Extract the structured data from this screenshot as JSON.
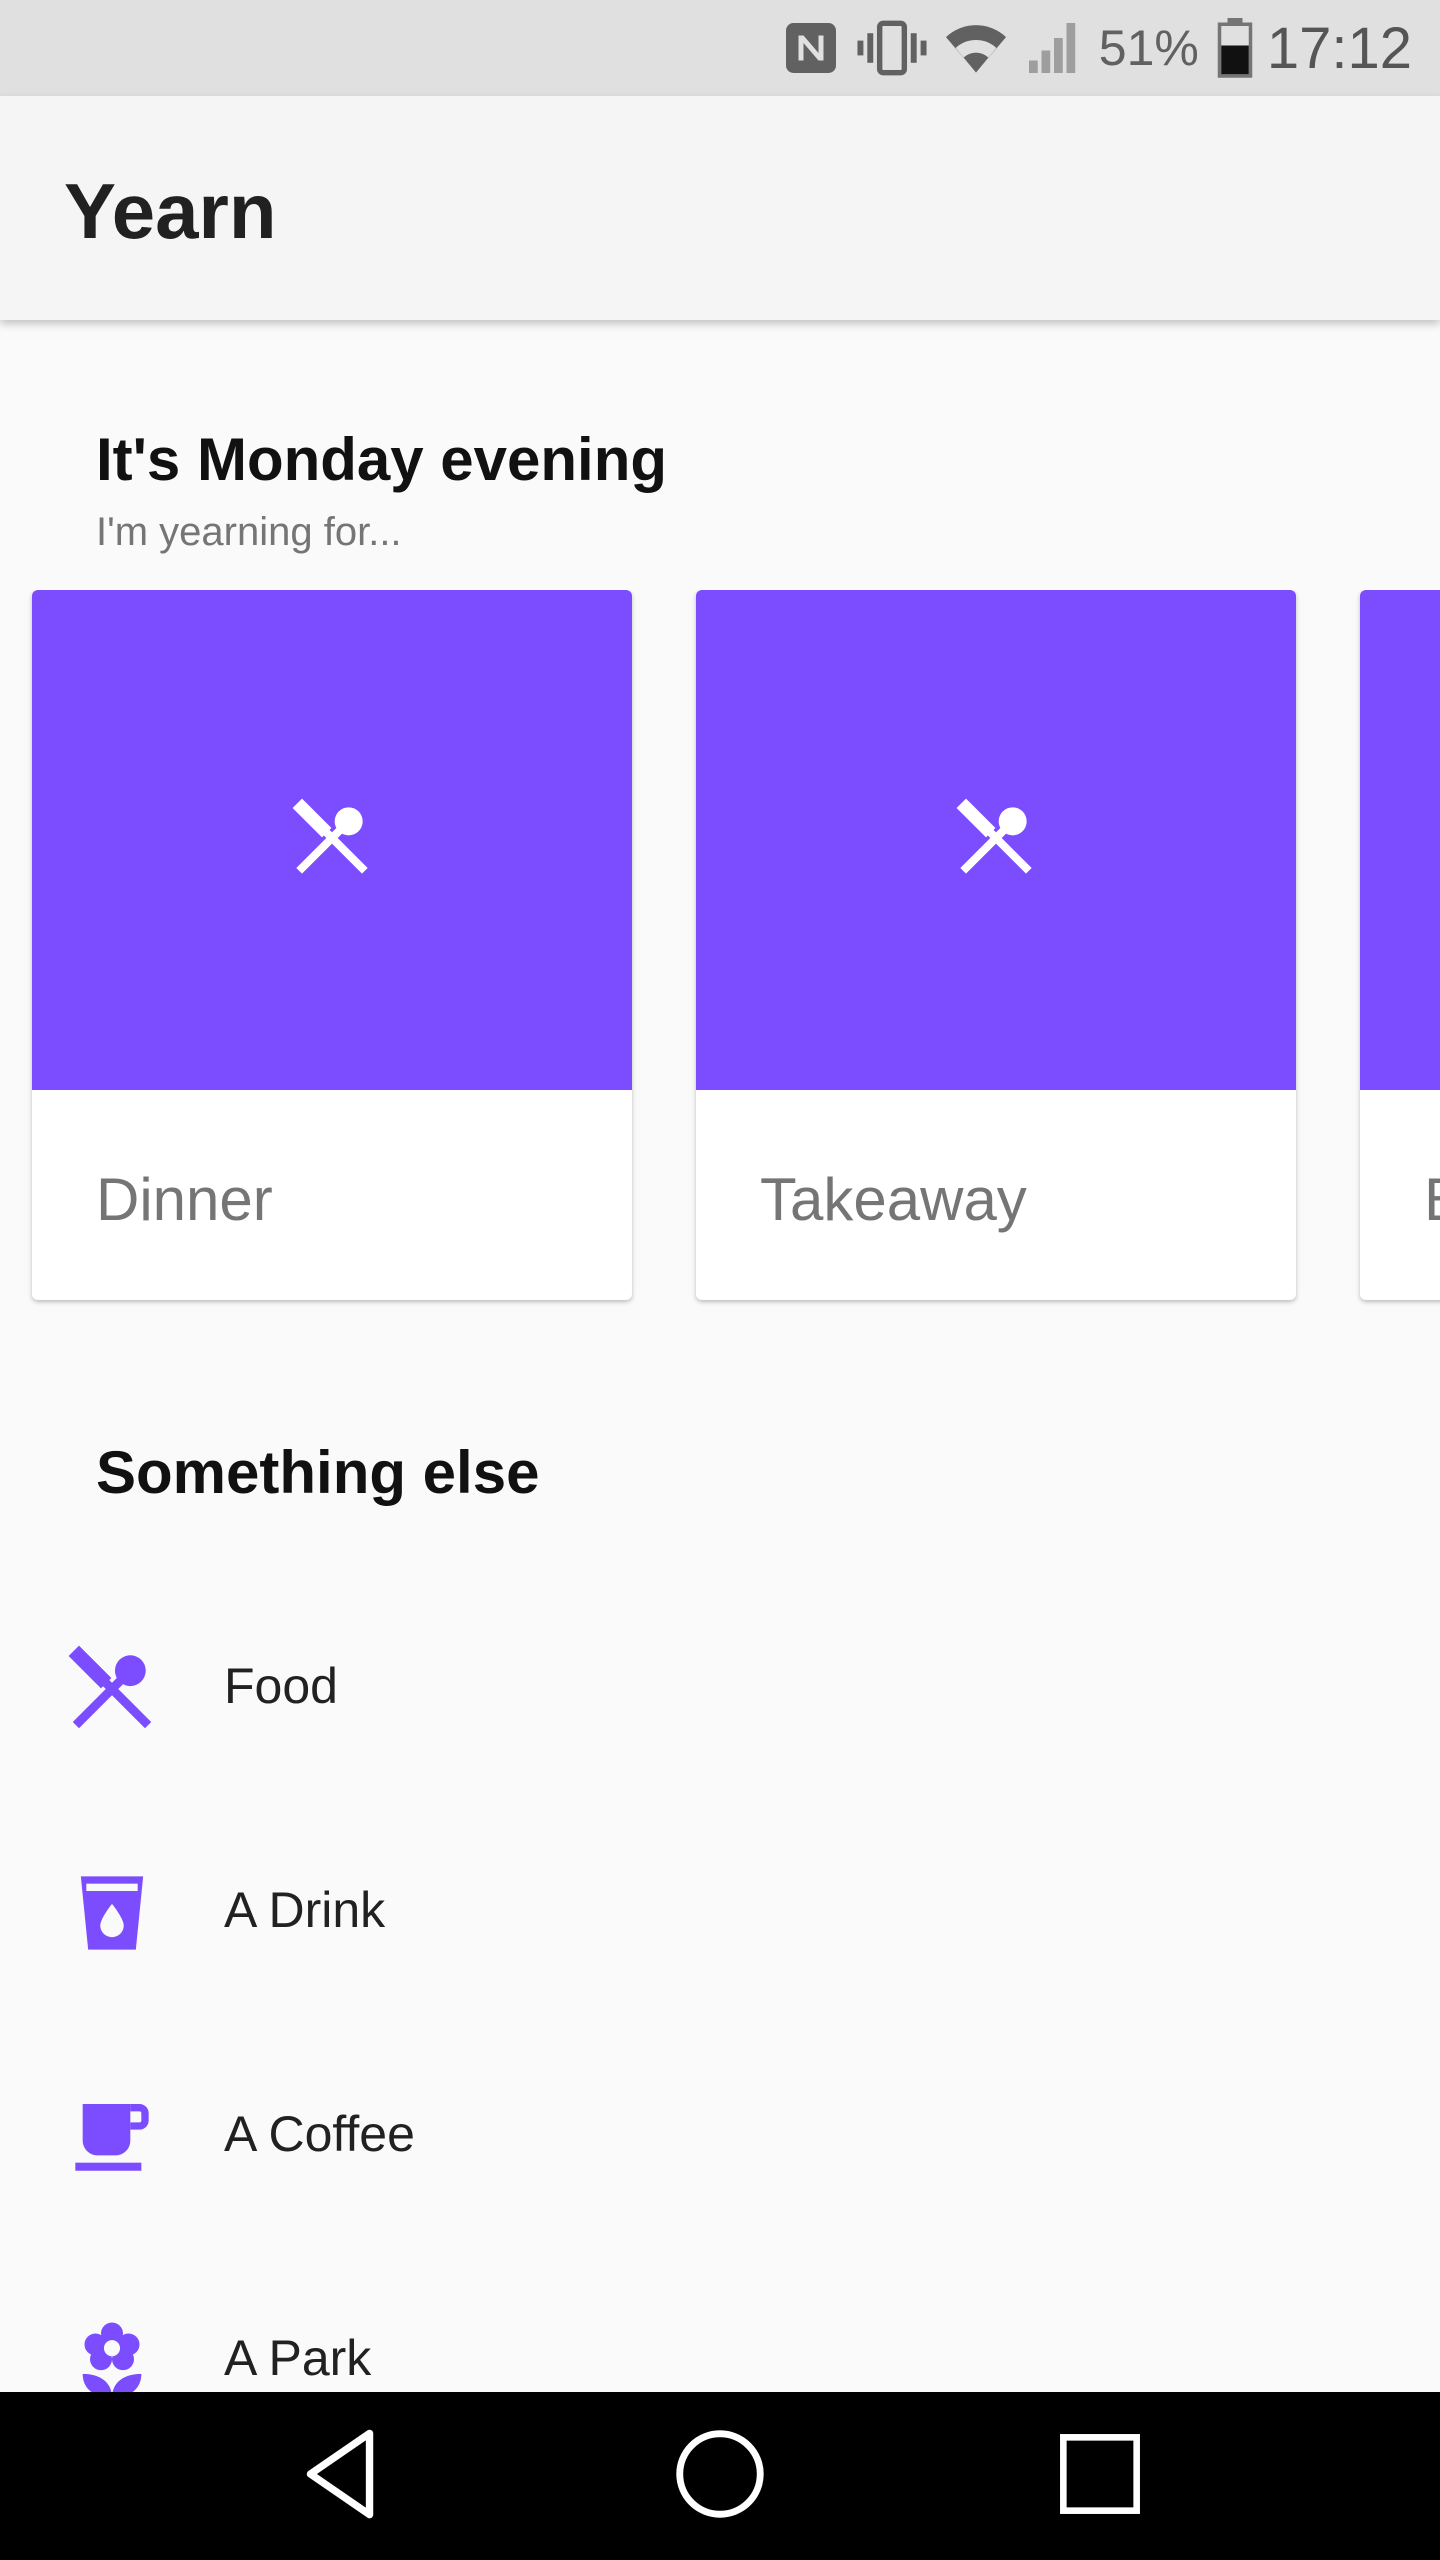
{
  "status_bar": {
    "battery_percent": "51%",
    "time": "17:12"
  },
  "app_bar": {
    "title": "Yearn"
  },
  "greeting": {
    "title": "It's Monday evening",
    "subtitle": "I'm yearning for..."
  },
  "cards": [
    {
      "label": "Dinner",
      "icon": "fork-spoon-icon"
    },
    {
      "label": "Takeaway",
      "icon": "fork-spoon-icon"
    },
    {
      "label": "B",
      "icon": "fork-spoon-icon"
    }
  ],
  "something_else": {
    "title": "Something else",
    "items": [
      {
        "label": "Food",
        "icon": "fork-spoon-icon"
      },
      {
        "label": "A Drink",
        "icon": "drink-cup-icon"
      },
      {
        "label": "A Coffee",
        "icon": "coffee-cup-icon"
      },
      {
        "label": "A Park",
        "icon": "flower-icon"
      }
    ]
  },
  "colors": {
    "accent": "#7c4dff",
    "status_bar": "#e0e0e0",
    "app_bar": "#f5f5f5",
    "nav_bar": "#000000"
  }
}
